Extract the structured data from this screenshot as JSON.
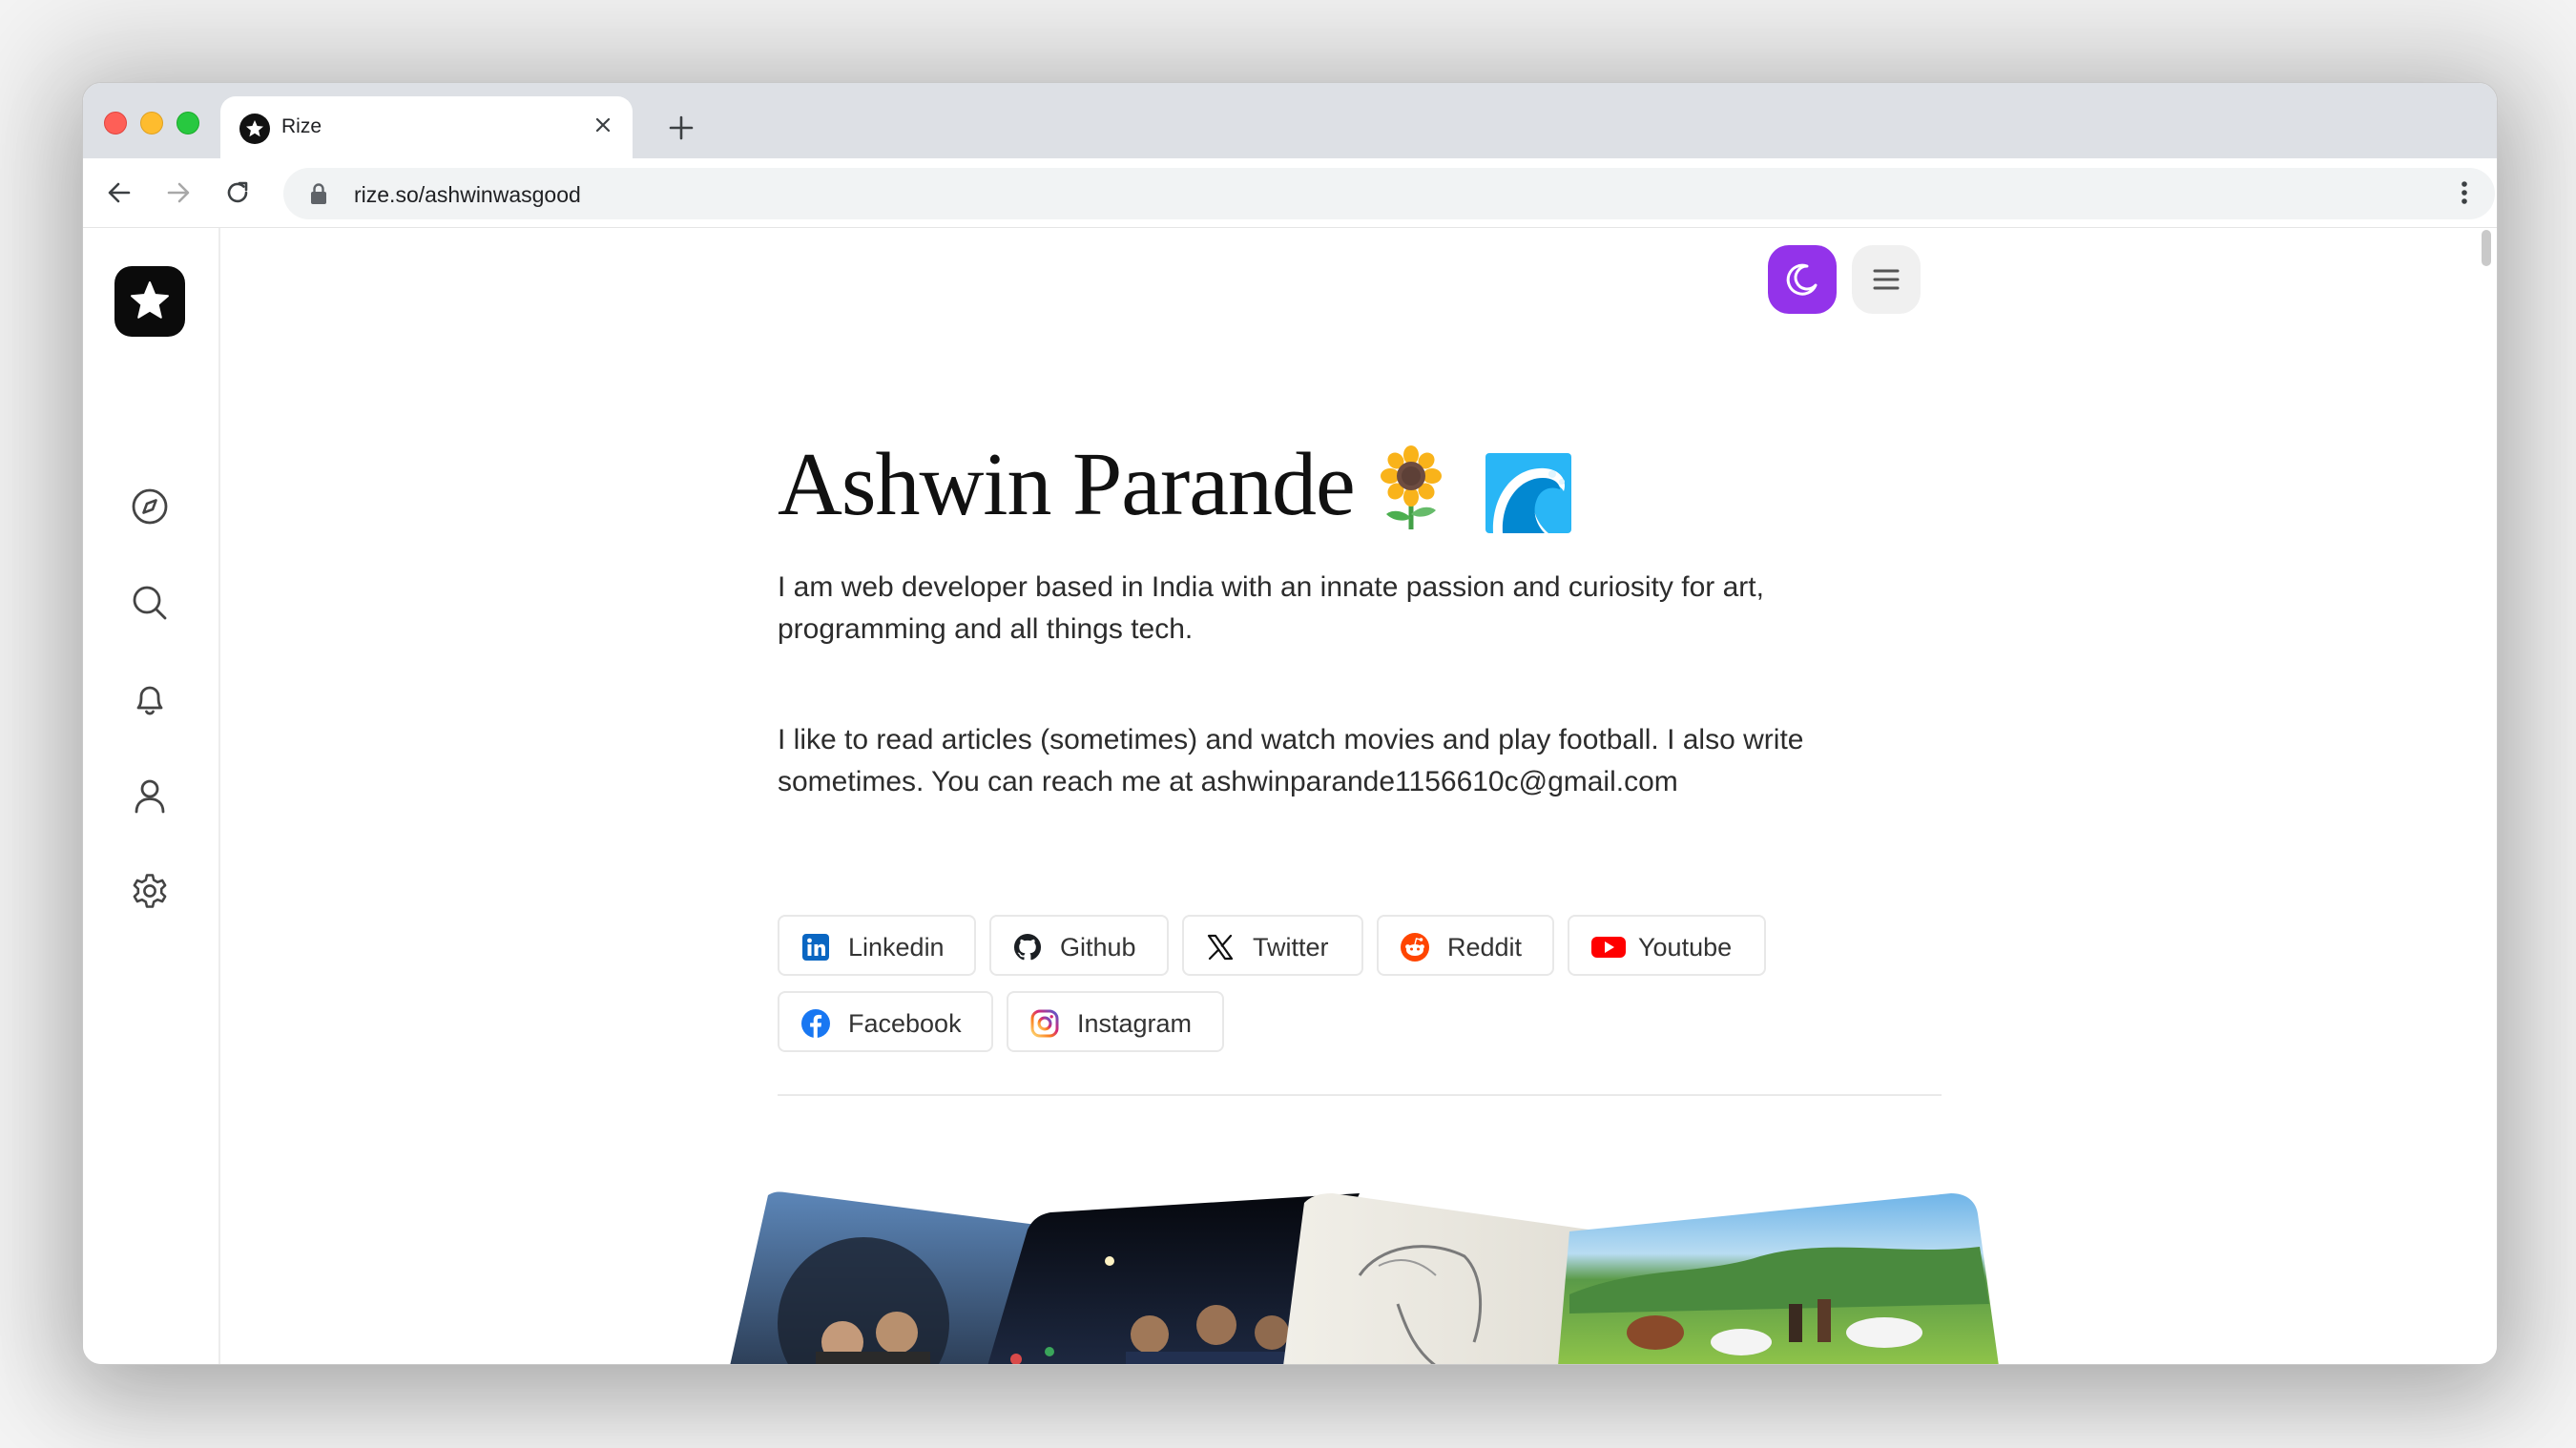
{
  "browser": {
    "tab_title": "Rize",
    "url": "rize.so/ashwinwasgood"
  },
  "profile": {
    "name": "Ashwin Parande",
    "emojis": [
      "sunflower",
      "wave"
    ],
    "bio_1": "I am web developer based in India with an innate passion and curiosity for art, programming and all things tech.",
    "bio_2": "I like to read articles (sometimes) and watch movies and play football. I also write sometimes. You can reach me at ashwinparande1156610c@gmail.com"
  },
  "links": [
    {
      "label": "Linkedin",
      "icon": "linkedin-icon"
    },
    {
      "label": "Github",
      "icon": "github-icon"
    },
    {
      "label": "Twitter",
      "icon": "x-icon"
    },
    {
      "label": "Reddit",
      "icon": "reddit-icon"
    },
    {
      "label": "Youtube",
      "icon": "youtube-icon"
    },
    {
      "label": "Facebook",
      "icon": "facebook-icon"
    },
    {
      "label": "Instagram",
      "icon": "instagram-icon"
    }
  ],
  "sidebar": {
    "items": [
      "explore-icon",
      "search-icon",
      "bell-icon",
      "user-icon",
      "gear-icon"
    ]
  },
  "colors": {
    "accent": "#9333ea",
    "linkedin": "#0a66c2",
    "reddit": "#ff4500",
    "youtube": "#ff0000",
    "facebook": "#1877f2"
  }
}
